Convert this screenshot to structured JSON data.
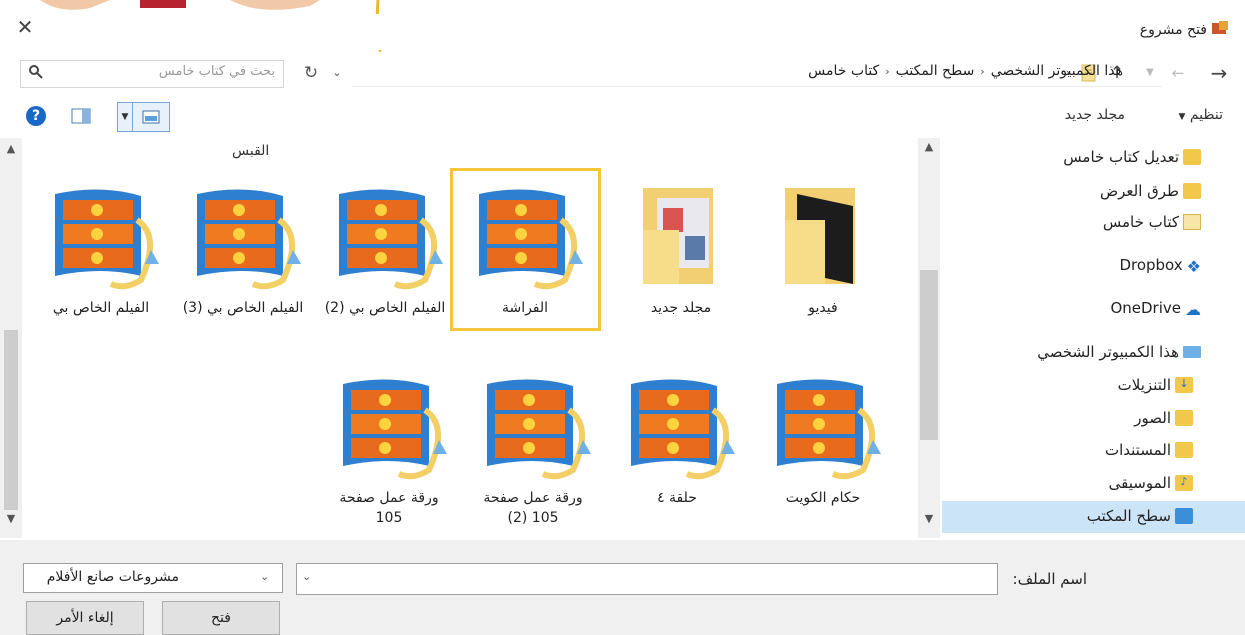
{
  "window": {
    "title": "فتح مشروع"
  },
  "address": {
    "crumbs": [
      "هذا الكمبيوتر الشخصي",
      "سطح المكتب",
      "كتاب خامس"
    ],
    "search_placeholder": "بحث في كتاب خامس"
  },
  "toolbar": {
    "organize": "تنظيم",
    "new_folder": "مجلد جديد",
    "help": "?"
  },
  "nav": {
    "items": [
      "تعديل كتاب خامس",
      "طرق العرض",
      "كتاب خامس",
      "Dropbox",
      "OneDrive",
      "هذا الكمبيوتر الشخصي",
      "التنزيلات",
      "الصور",
      "المستندات",
      "الموسيقى",
      "سطح المكتب"
    ],
    "selected": "سطح المكتب"
  },
  "content": {
    "group_header": "القبس",
    "row1": [
      {
        "label": "فيديو",
        "type": "folder-dark"
      },
      {
        "label": "مجلد جديد",
        "type": "folder-docs"
      },
      {
        "label": "الفراشة",
        "type": "movie",
        "highlighted": true
      },
      {
        "label": "الفيلم الخاص بي (2)",
        "type": "movie"
      },
      {
        "label": "الفيلم الخاص بي (3)",
        "type": "movie"
      },
      {
        "label": "الفيلم الخاص بي",
        "type": "movie"
      }
    ],
    "row2": [
      {
        "label": "حكام الكويت",
        "type": "movie"
      },
      {
        "label": "حلقة ٤",
        "type": "movie"
      },
      {
        "label": "ورقة عمل صفحة 105 (2)",
        "type": "movie"
      },
      {
        "label": "ورقة عمل صفحة 105",
        "type": "movie"
      }
    ]
  },
  "bottom": {
    "filename_label": "اسم الملف:",
    "filename_value": "",
    "filetype": "مشروعات صانع الأفلام",
    "open": "فتح",
    "cancel": "إلغاء الأمر"
  },
  "colors": {
    "highlight": "#f3c53b",
    "selected_bg": "#cce4f7",
    "accent": "#1b66c9"
  }
}
